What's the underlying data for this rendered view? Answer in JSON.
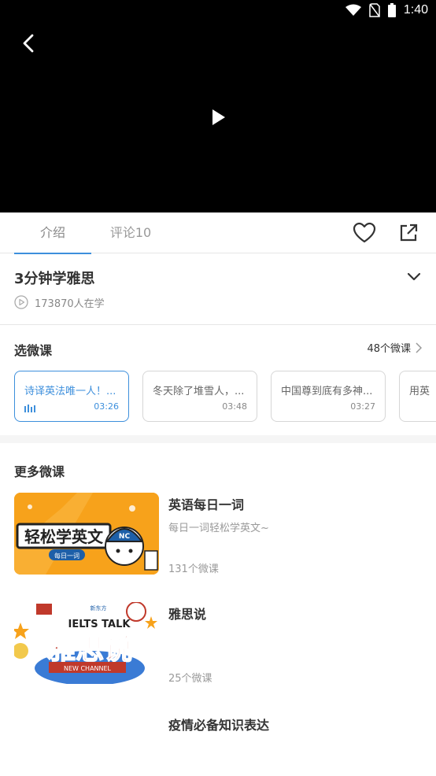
{
  "status": {
    "time": "1:40"
  },
  "tabs": [
    {
      "label": "介绍"
    },
    {
      "label": "评论10"
    }
  ],
  "course": {
    "title": "3分钟学雅思",
    "learners": "173870人在学"
  },
  "select": {
    "label": "选微课",
    "count": "48个微课",
    "lessons": [
      {
        "title": "诗译英法唯一人！...",
        "duration": "03:26"
      },
      {
        "title": "冬天除了堆雪人，...",
        "duration": "03:48"
      },
      {
        "title": "中国尊到底有多神...",
        "duration": "03:27"
      },
      {
        "title": "用英",
        "duration": ""
      }
    ]
  },
  "more": {
    "label": "更多微课",
    "items": [
      {
        "title": "英语每日一词",
        "desc": "每日一词轻松学英文~",
        "count": "131个微课",
        "thumb_text": "轻松学英文",
        "thumb_sub": "每日一词",
        "thumb_badge": "NC"
      },
      {
        "title": "雅思说",
        "desc": "",
        "count": "25个微课",
        "thumb_text": "雅思说",
        "thumb_top": "IELTS TALK",
        "thumb_sub": "NEW CHANNEL"
      },
      {
        "title": "疫情必备知识表达",
        "desc": "",
        "count": ""
      }
    ]
  },
  "colors": {
    "accent": "#3d8fdc",
    "thumb_orange": "#f7a21b"
  }
}
